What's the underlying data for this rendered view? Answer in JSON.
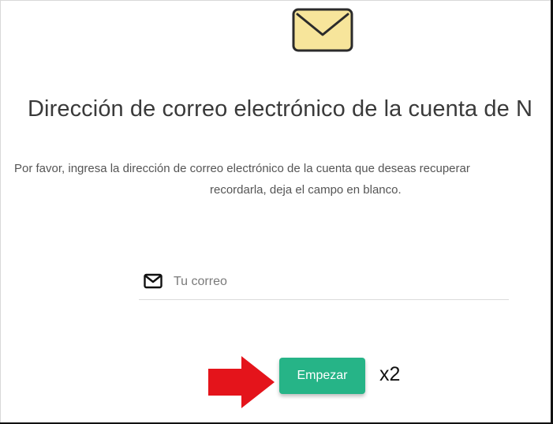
{
  "header": {
    "icon": "envelope-icon",
    "title": "Dirección de correo electrónico de la cuenta de N"
  },
  "description": {
    "line1": "Por favor, ingresa la dirección de correo electrónico de la cuenta que deseas recuperar",
    "line2": "recordarla, deja el campo en blanco."
  },
  "email": {
    "icon": "mail-icon",
    "placeholder": "Tu correo",
    "value": ""
  },
  "actions": {
    "start_label": "Empezar"
  },
  "annotation": {
    "pointer": "red-arrow-icon",
    "repeat": "x2"
  },
  "colors": {
    "accent": "#26b487",
    "envelope_fill": "#f7e59b",
    "arrow": "#e4141b",
    "title": "#3a3a3a"
  }
}
